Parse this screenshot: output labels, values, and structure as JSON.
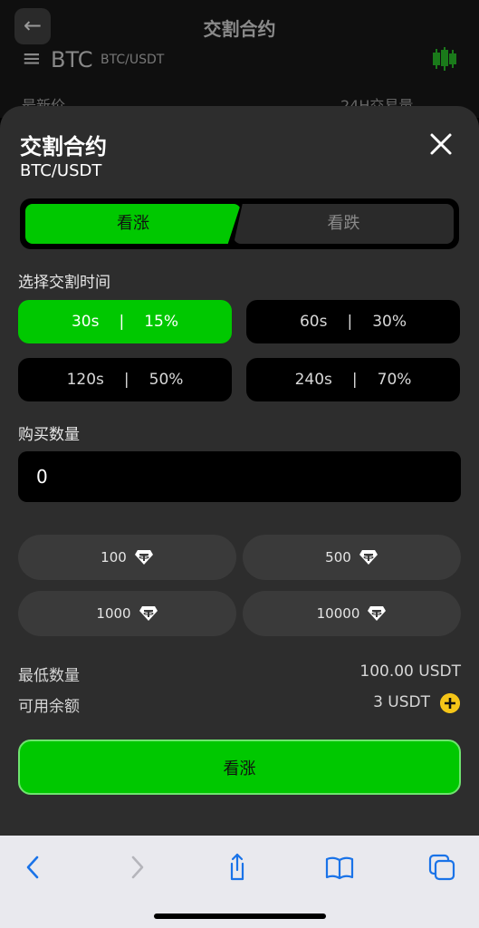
{
  "background": {
    "title": "交割合约",
    "pair": "BTC",
    "pair_sub": "BTC/USDT",
    "latest_label": "最新价",
    "volume_label": "24H交易量",
    "menu_glyph": "≡",
    "back_glyph": "←"
  },
  "sheet": {
    "title": "交割合约",
    "pair": "BTC/USDT",
    "direction": {
      "up_label": "看涨",
      "down_label": "看跌",
      "selected": "up"
    },
    "time_section_label": "选择交割时间",
    "time_options": [
      {
        "time": "30s",
        "sep": "|",
        "rate": "15%",
        "active": true
      },
      {
        "time": "60s",
        "sep": "|",
        "rate": "30%",
        "active": false
      },
      {
        "time": "120s",
        "sep": "|",
        "rate": "50%",
        "active": false
      },
      {
        "time": "240s",
        "sep": "|",
        "rate": "70%",
        "active": false
      }
    ],
    "quantity_label": "购买数量",
    "quantity_value": "0",
    "presets": [
      {
        "amount": "100"
      },
      {
        "amount": "500"
      },
      {
        "amount": "1000"
      },
      {
        "amount": "10000"
      }
    ],
    "min_label": "最低数量",
    "min_value": "100.00 USDT",
    "balance_label": "可用余额",
    "balance_value": "3 USDT",
    "submit_label": "看涨"
  },
  "colors": {
    "accent_green": "#00c800",
    "plus_yellow": "#f5c518",
    "ios_blue": "#1a73e8"
  }
}
